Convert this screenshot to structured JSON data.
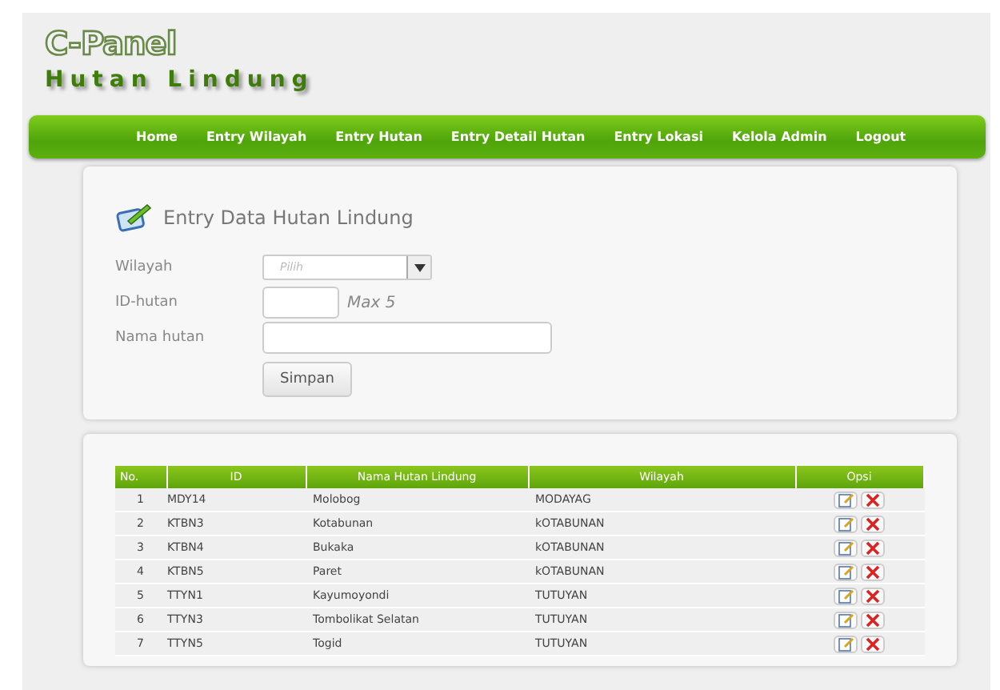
{
  "logo": {
    "title": "C-Panel",
    "subtitle": "Hutan Lindung"
  },
  "nav": [
    {
      "label": "Home"
    },
    {
      "label": "Entry Wilayah"
    },
    {
      "label": "Entry Hutan"
    },
    {
      "label": "Entry Detail Hutan"
    },
    {
      "label": "Entry Lokasi"
    },
    {
      "label": "Kelola Admin"
    },
    {
      "label": "Logout"
    }
  ],
  "form": {
    "title": "Entry Data Hutan Lindung",
    "fields": [
      {
        "kind": "select",
        "label": "Wilayah",
        "placeholder": "Pilih"
      },
      {
        "kind": "short",
        "label": "ID-hutan",
        "hint": "Max 5"
      },
      {
        "kind": "text",
        "label": "Nama hutan"
      }
    ],
    "submit": "Simpan"
  },
  "table": {
    "columns": [
      "No.",
      "ID",
      "Nama Hutan Lindung",
      "Wilayah",
      "Opsi"
    ],
    "rows": [
      {
        "no": "1",
        "id": "MDY14",
        "nama": "Molobog",
        "wilayah": "MODAYAG"
      },
      {
        "no": "2",
        "id": "KTBN3",
        "nama": "Kotabunan",
        "wilayah": "kOTABUNAN"
      },
      {
        "no": "3",
        "id": "KTBN4",
        "nama": "Bukaka",
        "wilayah": "kOTABUNAN"
      },
      {
        "no": "4",
        "id": "KTBN5",
        "nama": "Paret",
        "wilayah": "kOTABUNAN"
      },
      {
        "no": "5",
        "id": "TTYN1",
        "nama": "Kayumoyondi",
        "wilayah": "TUTUYAN"
      },
      {
        "no": "6",
        "id": "TTYN3",
        "nama": "Tombolikat Selatan",
        "wilayah": "TUTUYAN"
      },
      {
        "no": "7",
        "id": "TTYN5",
        "nama": "Togid",
        "wilayah": "TUTUYAN"
      }
    ]
  }
}
